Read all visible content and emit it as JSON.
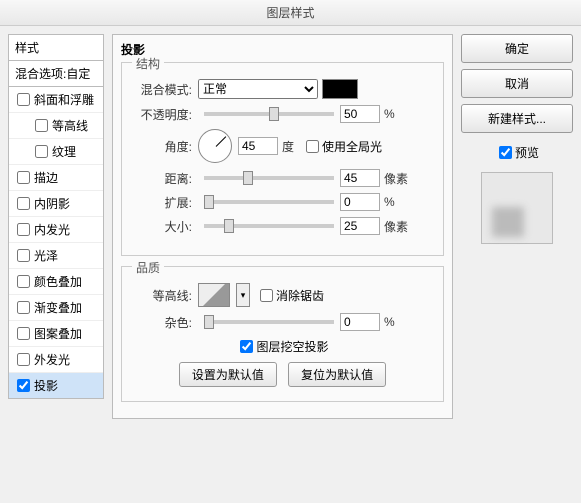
{
  "title": "图层样式",
  "left": {
    "header": "样式",
    "sub": "混合选项:自定",
    "items": [
      {
        "label": "斜面和浮雕",
        "checked": false,
        "indent": false
      },
      {
        "label": "等高线",
        "checked": false,
        "indent": true
      },
      {
        "label": "纹理",
        "checked": false,
        "indent": true
      },
      {
        "label": "描边",
        "checked": false,
        "indent": false
      },
      {
        "label": "内阴影",
        "checked": false,
        "indent": false
      },
      {
        "label": "内发光",
        "checked": false,
        "indent": false
      },
      {
        "label": "光泽",
        "checked": false,
        "indent": false
      },
      {
        "label": "颜色叠加",
        "checked": false,
        "indent": false
      },
      {
        "label": "渐变叠加",
        "checked": false,
        "indent": false
      },
      {
        "label": "图案叠加",
        "checked": false,
        "indent": false
      },
      {
        "label": "外发光",
        "checked": false,
        "indent": false
      },
      {
        "label": "投影",
        "checked": true,
        "indent": false,
        "selected": true
      }
    ]
  },
  "center": {
    "title": "投影",
    "section1": "结构",
    "section2": "品质",
    "blendMode": {
      "label": "混合模式:",
      "value": "正常"
    },
    "opacity": {
      "label": "不透明度:",
      "value": "50",
      "unit": "%",
      "pos": 50
    },
    "angle": {
      "label": "角度:",
      "value": "45",
      "unit": "度"
    },
    "globalLight": {
      "label": "使用全局光",
      "checked": false
    },
    "distance": {
      "label": "距离:",
      "value": "45",
      "unit": "像素",
      "pos": 30
    },
    "spread": {
      "label": "扩展:",
      "value": "0",
      "unit": "%",
      "pos": 0
    },
    "size": {
      "label": "大小:",
      "value": "25",
      "unit": "像素",
      "pos": 15
    },
    "contour": {
      "label": "等高线:"
    },
    "antialias": {
      "label": "消除锯齿",
      "checked": false
    },
    "noise": {
      "label": "杂色:",
      "value": "0",
      "unit": "%",
      "pos": 0
    },
    "knockout": {
      "label": "图层挖空投影",
      "checked": true
    },
    "setDefault": "设置为默认值",
    "resetDefault": "复位为默认值"
  },
  "right": {
    "ok": "确定",
    "cancel": "取消",
    "newStyle": "新建样式...",
    "preview": {
      "label": "预览",
      "checked": true
    }
  }
}
